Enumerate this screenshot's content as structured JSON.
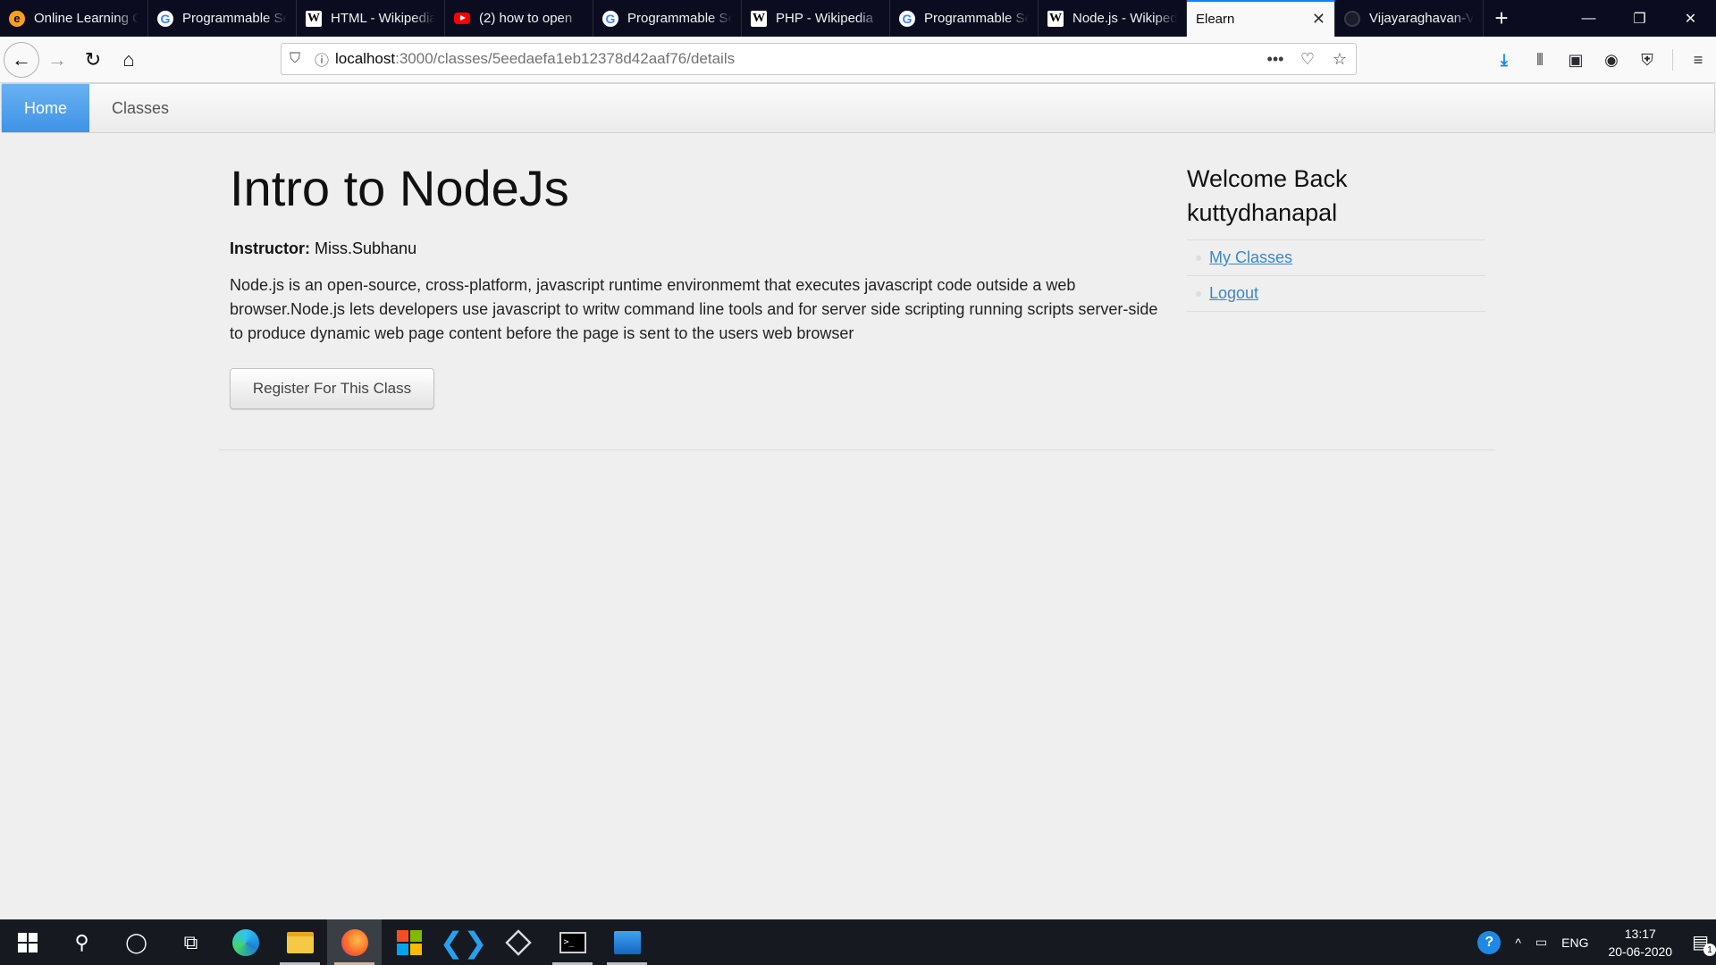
{
  "browser": {
    "tabs": [
      {
        "title": "Online Learning Community",
        "favicon": "elearn"
      },
      {
        "title": "Programmable Search Engine",
        "favicon": "google"
      },
      {
        "title": "HTML - Wikipedia",
        "favicon": "wikipedia"
      },
      {
        "title": "(2) how to open",
        "favicon": "youtube"
      },
      {
        "title": "Programmable Search Engine",
        "favicon": "google"
      },
      {
        "title": "PHP - Wikipedia",
        "favicon": "wikipedia"
      },
      {
        "title": "Programmable Search Engine",
        "favicon": "google"
      },
      {
        "title": "Node.js - Wikipedia",
        "favicon": "wikipedia"
      },
      {
        "title": "Elearn",
        "favicon": "none",
        "active": true
      },
      {
        "title": "Vijayaraghavan-V",
        "favicon": "github"
      }
    ],
    "new_tab_glyph": "+",
    "url_host": "localhost",
    "url_path": ":3000/classes/5eedaefa1eb12378d42aaf76/details"
  },
  "site": {
    "nav": [
      {
        "label": "Home",
        "active": true
      },
      {
        "label": "Classes",
        "active": false
      }
    ]
  },
  "course": {
    "title": "Intro to NodeJs",
    "instructor_label": "Instructor:",
    "instructor_name": "Miss.Subhanu",
    "description": "Node.js is an open-source, cross-platform, javascript runtime environmemt that executes javascript code outside a web browser.Node.js lets developers use javascript to writw command line tools and for server side scripting running scripts server-side to produce dynamic web page content before the page is sent to the users web browser",
    "register_label": "Register For This Class"
  },
  "sidebar": {
    "welcome": "Welcome Back kuttydhanapal",
    "links": [
      {
        "label": "My Classes"
      },
      {
        "label": "Logout"
      }
    ]
  },
  "taskbar": {
    "language": "ENG",
    "time": "13:17",
    "date": "20-06-2020",
    "notification_count": "1"
  },
  "colors": {
    "accent": "#0a84ff",
    "nav_active": "#4a9de9",
    "link": "#3a87c8",
    "page_bg": "#efefef"
  }
}
